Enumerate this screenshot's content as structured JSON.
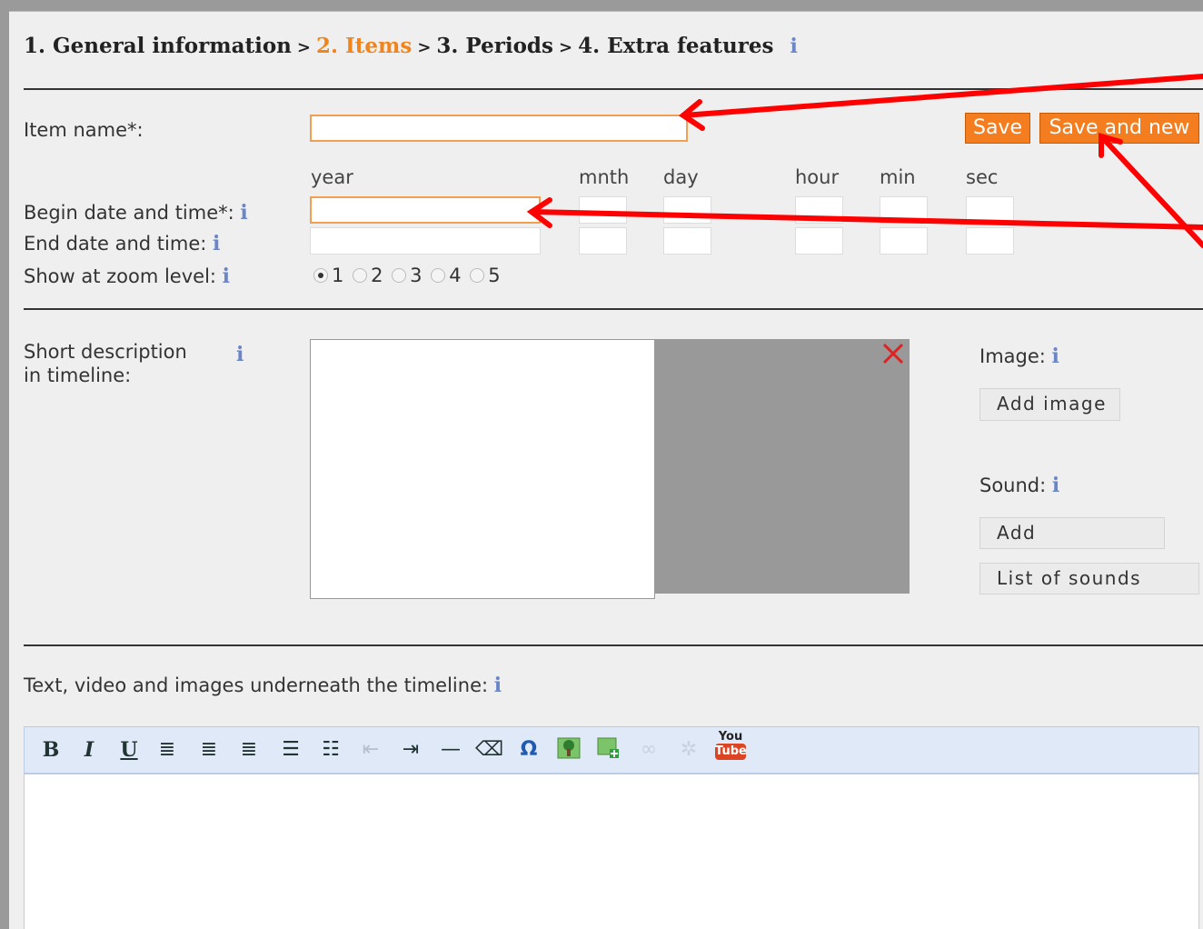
{
  "breadcrumb": {
    "step1": "1. General information",
    "step2": "2. Items",
    "step3": "3. Periods",
    "step4": "4. Extra features",
    "separator": ">"
  },
  "form": {
    "item_name_label": "Item name*:",
    "begin_label": "Begin date and time*:",
    "end_label": "End date and time:",
    "zoom_label": "Show at zoom level:",
    "columns": {
      "year": "year",
      "month": "mnth",
      "day": "day",
      "hour": "hour",
      "min": "min",
      "sec": "sec"
    },
    "zoom_options": [
      "1",
      "2",
      "3",
      "4",
      "5"
    ],
    "zoom_selected": "1",
    "short_desc_label_1": "Short description",
    "short_desc_label_2": "in timeline:",
    "image_label": "Image:",
    "add_image": "Add image",
    "sound_label": "Sound:",
    "add_sound": "Add",
    "list_sounds": "List of sounds",
    "underneath_label": "Text, video and images underneath the timeline:"
  },
  "buttons": {
    "save": "Save",
    "save_new": "Save and new"
  },
  "info_glyph": "i",
  "toolbar_icons": [
    "bold-icon",
    "italic-icon",
    "underline-icon",
    "align-left-icon",
    "align-center-icon",
    "align-right-icon",
    "bullet-list-icon",
    "numbered-list-icon",
    "outdent-icon",
    "indent-icon",
    "horizontal-rule-icon",
    "eraser-icon",
    "omega-icon",
    "insert-image-icon",
    "image-edit-icon",
    "link-icon",
    "unlink-icon",
    "youtube-icon"
  ],
  "youtube_text": {
    "top": "You",
    "bottom": "Tube"
  },
  "colors": {
    "accent": "#f47d1f",
    "arrow": "#ff0000",
    "info": "#6b86c6"
  }
}
